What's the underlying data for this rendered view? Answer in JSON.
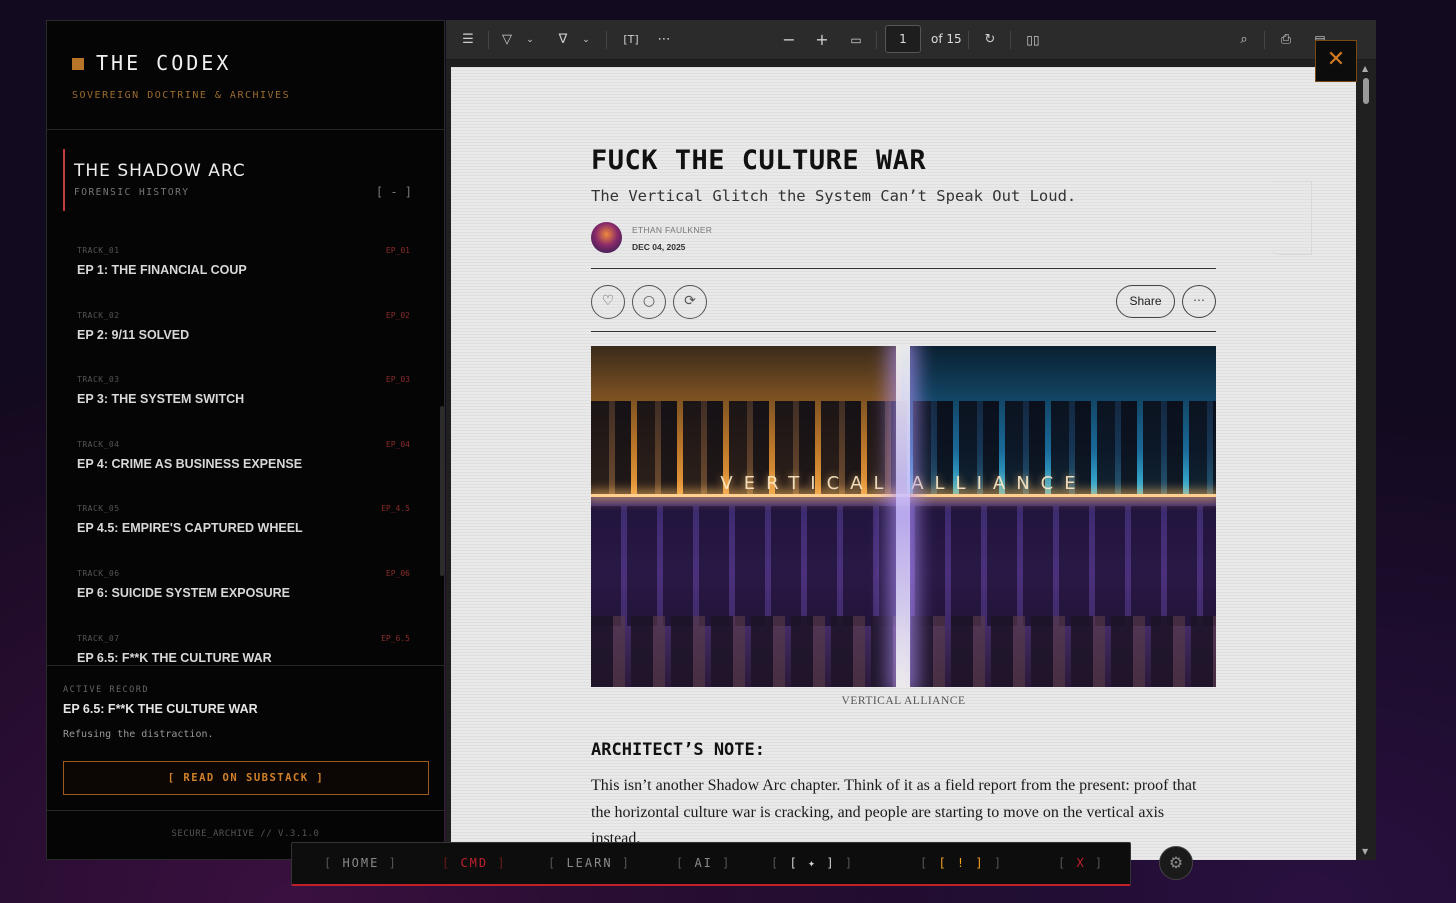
{
  "brand": {
    "title": "THE CODEX",
    "subtitle": "SOVEREIGN DOCTRINE & ARCHIVES"
  },
  "section": {
    "title": "THE SHADOW ARC",
    "subtitle": "FORENSIC HISTORY",
    "toggle": "[ - ]"
  },
  "tracks": [
    {
      "id": "TRACK_01",
      "ep": "EP_01",
      "title": "EP 1: THE FINANCIAL COUP"
    },
    {
      "id": "TRACK_02",
      "ep": "EP_02",
      "title": "EP 2: 9/11 SOLVED"
    },
    {
      "id": "TRACK_03",
      "ep": "EP_03",
      "title": "EP 3: THE SYSTEM SWITCH"
    },
    {
      "id": "TRACK_04",
      "ep": "EP_04",
      "title": "EP 4: CRIME AS BUSINESS EXPENSE"
    },
    {
      "id": "TRACK_05",
      "ep": "EP_4.5",
      "title": "EP 4.5: EMPIRE'S CAPTURED WHEEL"
    },
    {
      "id": "TRACK_06",
      "ep": "EP_06",
      "title": "EP 6: SUICIDE SYSTEM EXPOSURE"
    },
    {
      "id": "TRACK_07",
      "ep": "EP_6.5",
      "title": "EP 6.5: F**K THE CULTURE WAR"
    }
  ],
  "active": {
    "label": "ACTIVE RECORD",
    "title": "EP 6.5: F**K THE CULTURE WAR",
    "desc": "Refusing the distraction.",
    "button": "[ READ ON SUBSTACK ]"
  },
  "footer": {
    "version": "SECURE_ARCHIVE // V.3.1.0"
  },
  "toolbar": {
    "page_value": "1",
    "page_of": "of 15"
  },
  "article": {
    "title": "FUCK THE CULTURE WAR",
    "subtitle": "The Vertical Glitch the System Can’t Speak Out Loud.",
    "author": "ETHAN FAULKNER",
    "date": "DEC 04, 2025",
    "share": "Share",
    "hero_text": "VERTICAL ALLIANCE",
    "caption": "VERTICAL ALLIANCE",
    "note_heading": "ARCHITECT’S NOTE:",
    "note_body": "This isn’t another Shadow Arc chapter. Think of it as a field report from the present: proof that the horizontal culture war is cracking, and people are starting to move on the vertical axis instead."
  },
  "dock": [
    {
      "label": "HOME",
      "color": "#8a8a8a"
    },
    {
      "label": "CMD",
      "color": "#c0202a"
    },
    {
      "label": "LEARN",
      "color": "#8a8a8a"
    },
    {
      "label": "AI",
      "color": "#8a8a8a"
    },
    {
      "label": "✦",
      "color": "#cfcfcf"
    },
    {
      "label": "!",
      "color": "#f0a020"
    },
    {
      "label": "X",
      "color": "#c0202a"
    }
  ],
  "icons": {
    "toc": "list-icon",
    "highlight": "highlighter-icon",
    "draw": "pen-icon",
    "text": "text-box-icon",
    "more": "ellipsis-icon",
    "zoom_out": "minus-icon",
    "zoom_in": "plus-icon",
    "fit": "fit-page-icon",
    "rotate": "rotate-icon",
    "two_page": "two-page-icon",
    "search": "search-icon",
    "print": "print-icon",
    "save": "save-icon",
    "close": "close-icon",
    "like": "heart-icon",
    "comment": "comment-icon",
    "restack": "restack-icon",
    "settings": "gear-icon"
  },
  "colors": {
    "accent": "#b8752a",
    "alert": "#c0202a"
  }
}
